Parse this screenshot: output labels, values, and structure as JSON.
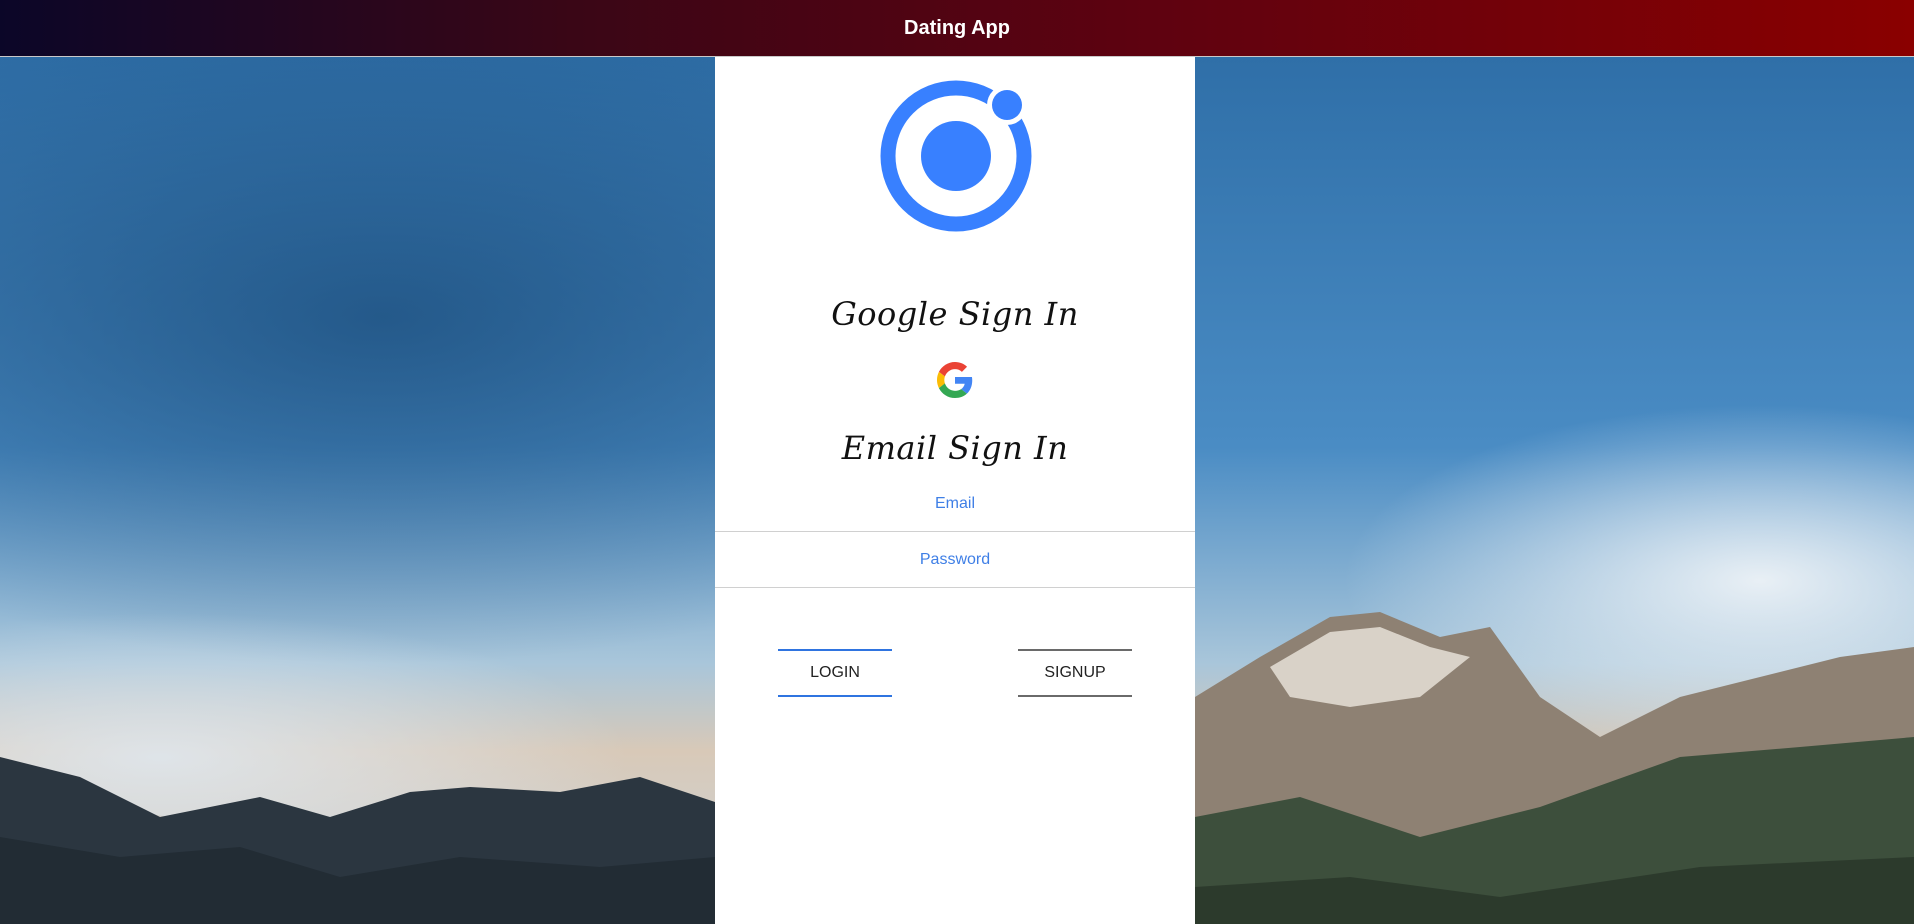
{
  "toolbar": {
    "title": "Dating App"
  },
  "panel": {
    "logo_icon": "ionic-logo-icon",
    "google_heading": "Google Sign In",
    "google_icon": "google-icon",
    "email_heading": "Email Sign In",
    "email_placeholder": "Email",
    "email_value": "",
    "password_placeholder": "Password",
    "password_value": "",
    "login_label": "LOGIN",
    "signup_label": "SIGNUP"
  },
  "colors": {
    "toolbar_gradient_start": "#0b0628",
    "toolbar_gradient_end": "#8a0000",
    "accent_blue": "#3880ff",
    "login_border": "#2f74e0",
    "signup_border": "#6a6a6a",
    "placeholder": "#3f7fe6"
  },
  "background": {
    "scene": "mountain-sky-image"
  }
}
